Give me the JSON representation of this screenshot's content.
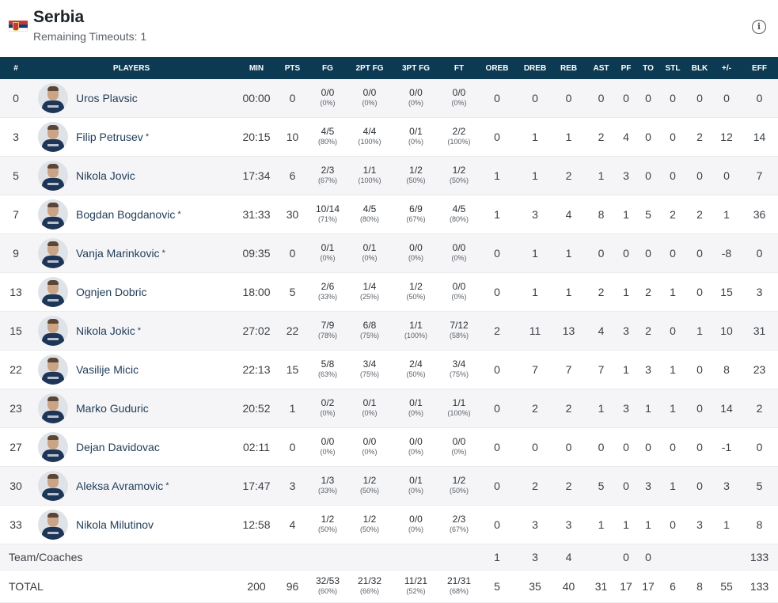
{
  "team": {
    "name": "Serbia",
    "timeouts": "Remaining Timeouts: 1",
    "flag_colors": [
      "#c6363c",
      "#0c4076",
      "#ffffff"
    ]
  },
  "icons": {
    "info": "info-icon"
  },
  "columns": [
    "#",
    "PLAYERS",
    "MIN",
    "PTS",
    "FG",
    "2PT FG",
    "3PT FG",
    "FT",
    "OREB",
    "DREB",
    "REB",
    "AST",
    "PF",
    "TO",
    "STL",
    "BLK",
    "+/-",
    "EFF"
  ],
  "players": [
    {
      "num": "0",
      "name": "Uros Plavsic",
      "star": "",
      "min": "00:00",
      "pts": "0",
      "fg": "0/0",
      "fg_pct": "(0%)",
      "fg2": "0/0",
      "fg2_pct": "(0%)",
      "fg3": "0/0",
      "fg3_pct": "(0%)",
      "ft": "0/0",
      "ft_pct": "(0%)",
      "oreb": "0",
      "dreb": "0",
      "reb": "0",
      "ast": "0",
      "pf": "0",
      "to": "0",
      "stl": "0",
      "blk": "0",
      "pm": "0",
      "eff": "0"
    },
    {
      "num": "3",
      "name": "Filip Petrusev",
      "star": "*",
      "min": "20:15",
      "pts": "10",
      "fg": "4/5",
      "fg_pct": "(80%)",
      "fg2": "4/4",
      "fg2_pct": "(100%)",
      "fg3": "0/1",
      "fg3_pct": "(0%)",
      "ft": "2/2",
      "ft_pct": "(100%)",
      "oreb": "0",
      "dreb": "1",
      "reb": "1",
      "ast": "2",
      "pf": "4",
      "to": "0",
      "stl": "0",
      "blk": "2",
      "pm": "12",
      "eff": "14"
    },
    {
      "num": "5",
      "name": "Nikola Jovic",
      "star": "",
      "min": "17:34",
      "pts": "6",
      "fg": "2/3",
      "fg_pct": "(67%)",
      "fg2": "1/1",
      "fg2_pct": "(100%)",
      "fg3": "1/2",
      "fg3_pct": "(50%)",
      "ft": "1/2",
      "ft_pct": "(50%)",
      "oreb": "1",
      "dreb": "1",
      "reb": "2",
      "ast": "1",
      "pf": "3",
      "to": "0",
      "stl": "0",
      "blk": "0",
      "pm": "0",
      "eff": "7"
    },
    {
      "num": "7",
      "name": "Bogdan Bogdanovic",
      "star": "*",
      "min": "31:33",
      "pts": "30",
      "fg": "10/14",
      "fg_pct": "(71%)",
      "fg2": "4/5",
      "fg2_pct": "(80%)",
      "fg3": "6/9",
      "fg3_pct": "(67%)",
      "ft": "4/5",
      "ft_pct": "(80%)",
      "oreb": "1",
      "dreb": "3",
      "reb": "4",
      "ast": "8",
      "pf": "1",
      "to": "5",
      "stl": "2",
      "blk": "2",
      "pm": "1",
      "eff": "36"
    },
    {
      "num": "9",
      "name": "Vanja Marinkovic",
      "star": "*",
      "min": "09:35",
      "pts": "0",
      "fg": "0/1",
      "fg_pct": "(0%)",
      "fg2": "0/1",
      "fg2_pct": "(0%)",
      "fg3": "0/0",
      "fg3_pct": "(0%)",
      "ft": "0/0",
      "ft_pct": "(0%)",
      "oreb": "0",
      "dreb": "1",
      "reb": "1",
      "ast": "0",
      "pf": "0",
      "to": "0",
      "stl": "0",
      "blk": "0",
      "pm": "-8",
      "eff": "0"
    },
    {
      "num": "13",
      "name": "Ognjen Dobric",
      "star": "",
      "min": "18:00",
      "pts": "5",
      "fg": "2/6",
      "fg_pct": "(33%)",
      "fg2": "1/4",
      "fg2_pct": "(25%)",
      "fg3": "1/2",
      "fg3_pct": "(50%)",
      "ft": "0/0",
      "ft_pct": "(0%)",
      "oreb": "0",
      "dreb": "1",
      "reb": "1",
      "ast": "2",
      "pf": "1",
      "to": "2",
      "stl": "1",
      "blk": "0",
      "pm": "15",
      "eff": "3"
    },
    {
      "num": "15",
      "name": "Nikola Jokic",
      "star": "*",
      "min": "27:02",
      "pts": "22",
      "fg": "7/9",
      "fg_pct": "(78%)",
      "fg2": "6/8",
      "fg2_pct": "(75%)",
      "fg3": "1/1",
      "fg3_pct": "(100%)",
      "ft": "7/12",
      "ft_pct": "(58%)",
      "oreb": "2",
      "dreb": "11",
      "reb": "13",
      "ast": "4",
      "pf": "3",
      "to": "2",
      "stl": "0",
      "blk": "1",
      "pm": "10",
      "eff": "31"
    },
    {
      "num": "22",
      "name": "Vasilije Micic",
      "star": "",
      "min": "22:13",
      "pts": "15",
      "fg": "5/8",
      "fg_pct": "(63%)",
      "fg2": "3/4",
      "fg2_pct": "(75%)",
      "fg3": "2/4",
      "fg3_pct": "(50%)",
      "ft": "3/4",
      "ft_pct": "(75%)",
      "oreb": "0",
      "dreb": "7",
      "reb": "7",
      "ast": "7",
      "pf": "1",
      "to": "3",
      "stl": "1",
      "blk": "0",
      "pm": "8",
      "eff": "23"
    },
    {
      "num": "23",
      "name": "Marko Guduric",
      "star": "",
      "min": "20:52",
      "pts": "1",
      "fg": "0/2",
      "fg_pct": "(0%)",
      "fg2": "0/1",
      "fg2_pct": "(0%)",
      "fg3": "0/1",
      "fg3_pct": "(0%)",
      "ft": "1/1",
      "ft_pct": "(100%)",
      "oreb": "0",
      "dreb": "2",
      "reb": "2",
      "ast": "1",
      "pf": "3",
      "to": "1",
      "stl": "1",
      "blk": "0",
      "pm": "14",
      "eff": "2"
    },
    {
      "num": "27",
      "name": "Dejan Davidovac",
      "star": "",
      "min": "02:11",
      "pts": "0",
      "fg": "0/0",
      "fg_pct": "(0%)",
      "fg2": "0/0",
      "fg2_pct": "(0%)",
      "fg3": "0/0",
      "fg3_pct": "(0%)",
      "ft": "0/0",
      "ft_pct": "(0%)",
      "oreb": "0",
      "dreb": "0",
      "reb": "0",
      "ast": "0",
      "pf": "0",
      "to": "0",
      "stl": "0",
      "blk": "0",
      "pm": "-1",
      "eff": "0"
    },
    {
      "num": "30",
      "name": "Aleksa Avramovic",
      "star": "*",
      "min": "17:47",
      "pts": "3",
      "fg": "1/3",
      "fg_pct": "(33%)",
      "fg2": "1/2",
      "fg2_pct": "(50%)",
      "fg3": "0/1",
      "fg3_pct": "(0%)",
      "ft": "1/2",
      "ft_pct": "(50%)",
      "oreb": "0",
      "dreb": "2",
      "reb": "2",
      "ast": "5",
      "pf": "0",
      "to": "3",
      "stl": "1",
      "blk": "0",
      "pm": "3",
      "eff": "5"
    },
    {
      "num": "33",
      "name": "Nikola Milutinov",
      "star": "",
      "min": "12:58",
      "pts": "4",
      "fg": "1/2",
      "fg_pct": "(50%)",
      "fg2": "1/2",
      "fg2_pct": "(50%)",
      "fg3": "0/0",
      "fg3_pct": "(0%)",
      "ft": "2/3",
      "ft_pct": "(67%)",
      "oreb": "0",
      "dreb": "3",
      "reb": "3",
      "ast": "1",
      "pf": "1",
      "to": "1",
      "stl": "0",
      "blk": "3",
      "pm": "1",
      "eff": "8"
    }
  ],
  "team_coaches": {
    "label": "Team/Coaches",
    "oreb": "1",
    "dreb": "3",
    "reb": "4",
    "pf": "0",
    "to": "0",
    "eff": "133"
  },
  "total": {
    "label": "TOTAL",
    "min": "200",
    "pts": "96",
    "fg": "32/53",
    "fg_pct": "(60%)",
    "fg2": "21/32",
    "fg2_pct": "(66%)",
    "fg3": "11/21",
    "fg3_pct": "(52%)",
    "ft": "21/31",
    "ft_pct": "(68%)",
    "oreb": "5",
    "dreb": "35",
    "reb": "40",
    "ast": "31",
    "pf": "17",
    "to": "17",
    "stl": "6",
    "blk": "8",
    "pm": "55",
    "eff": "133"
  }
}
